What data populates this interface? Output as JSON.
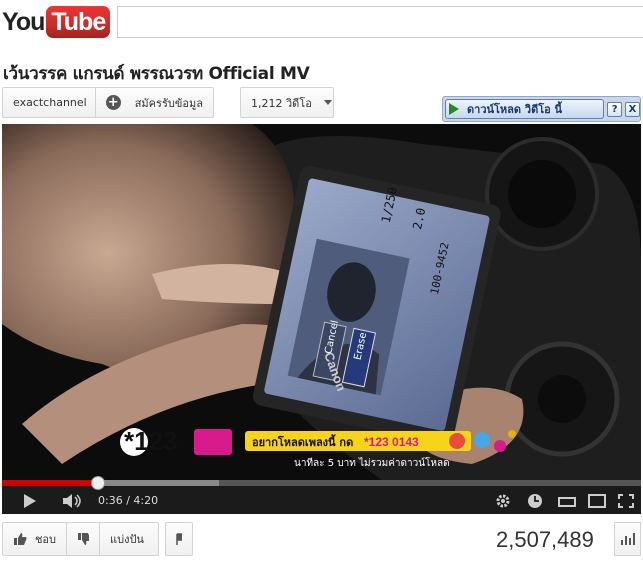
{
  "logo": {
    "part1": "You",
    "part2": "Tube"
  },
  "search": {
    "value": "",
    "placeholder": ""
  },
  "video_title": "เว้นวรรค แกรนด์ พรรณวรท Official MV",
  "channel": {
    "name": "exactchannel",
    "subscribe_label": "สมัครรับข้อมูล",
    "videos_label": "1,212 วิดีโอ"
  },
  "download_toolbar": {
    "button_label": "ดาวน์โหลด วิดีโอ นี้",
    "help": "?",
    "close": "X"
  },
  "player": {
    "progress": 0.15,
    "loaded": 0.34,
    "time_current": "0:36",
    "time_total": "4:20",
    "overlay": {
      "logo": "*123",
      "cta": "อยากโหลดเพลงนี้ กด",
      "code": "*123 0143",
      "note": "นาทีละ 5 บาท ไม่รวมค่าดาวน์โหลด",
      "camera_brand": "Canon",
      "screen_shutter": "1/250",
      "screen_aperture": "2.0",
      "screen_file": "100-9452",
      "screen_cancel": "Cancel",
      "screen_erase": "Erase"
    }
  },
  "actions": {
    "like_label": "ชอบ",
    "share_label": "แบ่งปัน"
  },
  "view_count": "2,507,489",
  "colors": {
    "youtube_red": "#c4302b",
    "progress_red": "#cc0000",
    "download_green": "#2a8a22"
  }
}
